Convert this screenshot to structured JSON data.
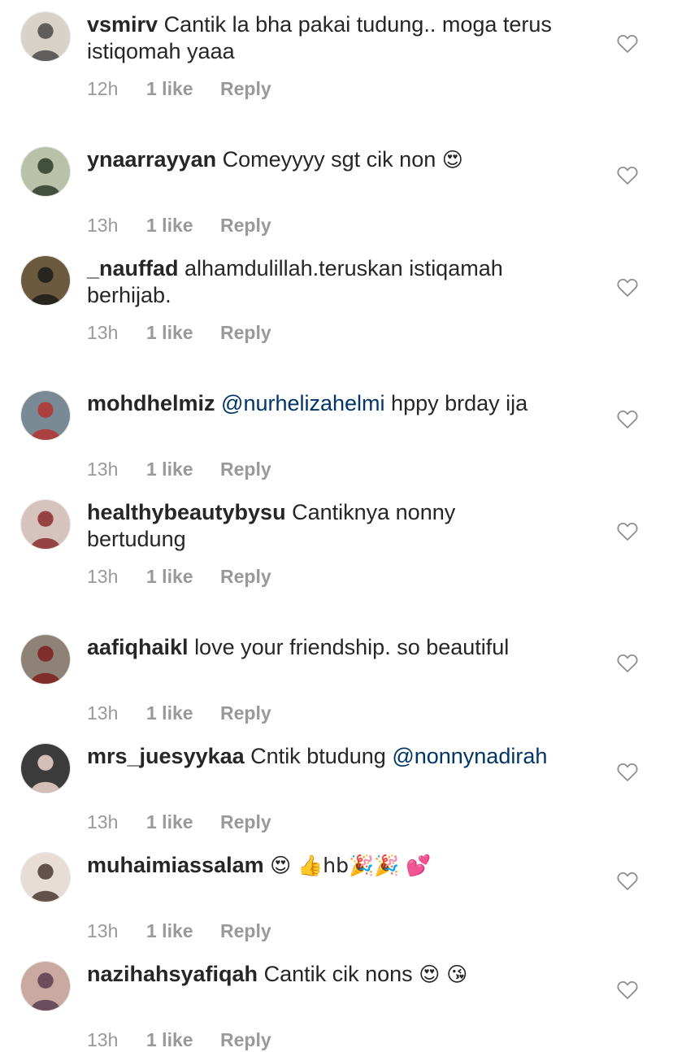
{
  "comments": [
    {
      "username": "vsmirv",
      "text": "Cantik la bha pakai tudung.. moga terus",
      "text2": "istiqomah yaaa",
      "mention": "",
      "after": "",
      "emoji": "",
      "time": "12h",
      "likes": "1 like",
      "reply": "Reply"
    },
    {
      "username": "ynaarrayyan",
      "text": "Comeyyyy sgt cik non",
      "text2": "",
      "mention": "",
      "after": "",
      "emoji": "😍",
      "time": "13h",
      "likes": "1 like",
      "reply": "Reply"
    },
    {
      "username": "_nauffad",
      "text": "alhamdulillah.teruskan istiqamah",
      "text2": "berhijab.",
      "mention": "",
      "after": "",
      "emoji": "",
      "time": "13h",
      "likes": "1 like",
      "reply": "Reply"
    },
    {
      "username": "mohdhelmiz",
      "text": "",
      "text2": "",
      "mention": "@nurhelizahelmi",
      "after": "hppy brday ija",
      "emoji": "",
      "time": "13h",
      "likes": "1 like",
      "reply": "Reply"
    },
    {
      "username": "healthybeautybysu",
      "text": "Cantiknya nonny",
      "text2": "bertudung",
      "mention": "",
      "after": "",
      "emoji": "",
      "time": "13h",
      "likes": "1 like",
      "reply": "Reply"
    },
    {
      "username": "aafiqhaikl",
      "text": "love your friendship. so beautiful",
      "text2": "",
      "mention": "",
      "after": "",
      "emoji": "",
      "time": "13h",
      "likes": "1 like",
      "reply": "Reply"
    },
    {
      "username": "mrs_juesyykaa",
      "text": "Cntik btudung",
      "text2": "",
      "mention": "@nonnynadirah",
      "after": "",
      "emoji": "",
      "time": "13h",
      "likes": "1 like",
      "reply": "Reply"
    },
    {
      "username": "muhaimiassalam",
      "text": "",
      "text2": "",
      "mention": "",
      "after": "",
      "emoji": "😍 👍hb🎉🎉 💕",
      "time": "13h",
      "likes": "1 like",
      "reply": "Reply"
    },
    {
      "username": "nazihahsyafiqah",
      "text": "Cantik cik nons",
      "text2": "",
      "mention": "",
      "after": "",
      "emoji": "😍 😘",
      "time": "13h",
      "likes": "1 like",
      "reply": "Reply"
    }
  ],
  "icons": {
    "avatar": "avatar-photo",
    "heart": "heart-outline-icon"
  },
  "colors": {
    "username": "#262626",
    "mention": "#003569",
    "meta": "#999999",
    "heart": "#8e8e8e"
  }
}
